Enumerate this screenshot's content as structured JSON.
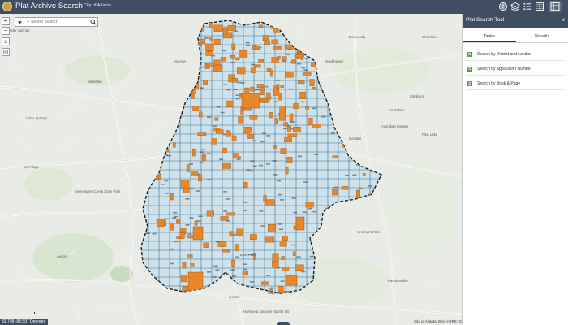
{
  "header": {
    "title": "Plat Archive Search",
    "subtitle": "City of Atlanta",
    "accent_color": "#3f4e60",
    "tools": [
      {
        "icon": "basemap-gallery-icon"
      },
      {
        "icon": "layers-icon"
      },
      {
        "icon": "list-icon"
      },
      {
        "icon": "grid-icon"
      },
      {
        "icon": "plat-search-tool-icon"
      }
    ]
  },
  "search": {
    "placeholder": "< Select Search"
  },
  "map": {
    "coordinates": "33.798 -84.597 Degrees",
    "attribution": "City of Atlanta, Esri, HERE, Garmin...",
    "highlight_color": "#e8862a",
    "grid_color": "#3a6f8f",
    "place_labels": [
      "Powder Springs",
      "Mableton",
      "Lithia Springs",
      "Smyrna",
      "Austell",
      "Scottdale",
      "Clarkston",
      "Decatur",
      "Avondale Estates",
      "Pine Lake",
      "Gresham Park",
      "Panthersville",
      "East Point",
      "Hapeville",
      "Conley",
      "Chamblee",
      "Dunwoody",
      "Brookhaven",
      "Hartsfield Jackson Atlanta Intl",
      "Six Flags",
      "Sweetwater Creek State Park"
    ]
  },
  "panel": {
    "title": "Plat Search Tool",
    "close_label": "×",
    "tabs": [
      {
        "label": "Tasks",
        "active": true
      },
      {
        "label": "Results",
        "active": false
      }
    ],
    "tasks": [
      {
        "label": "Search by District and Landlot"
      },
      {
        "label": "Search by Application Number"
      },
      {
        "label": "Search by Book & Page"
      }
    ]
  }
}
